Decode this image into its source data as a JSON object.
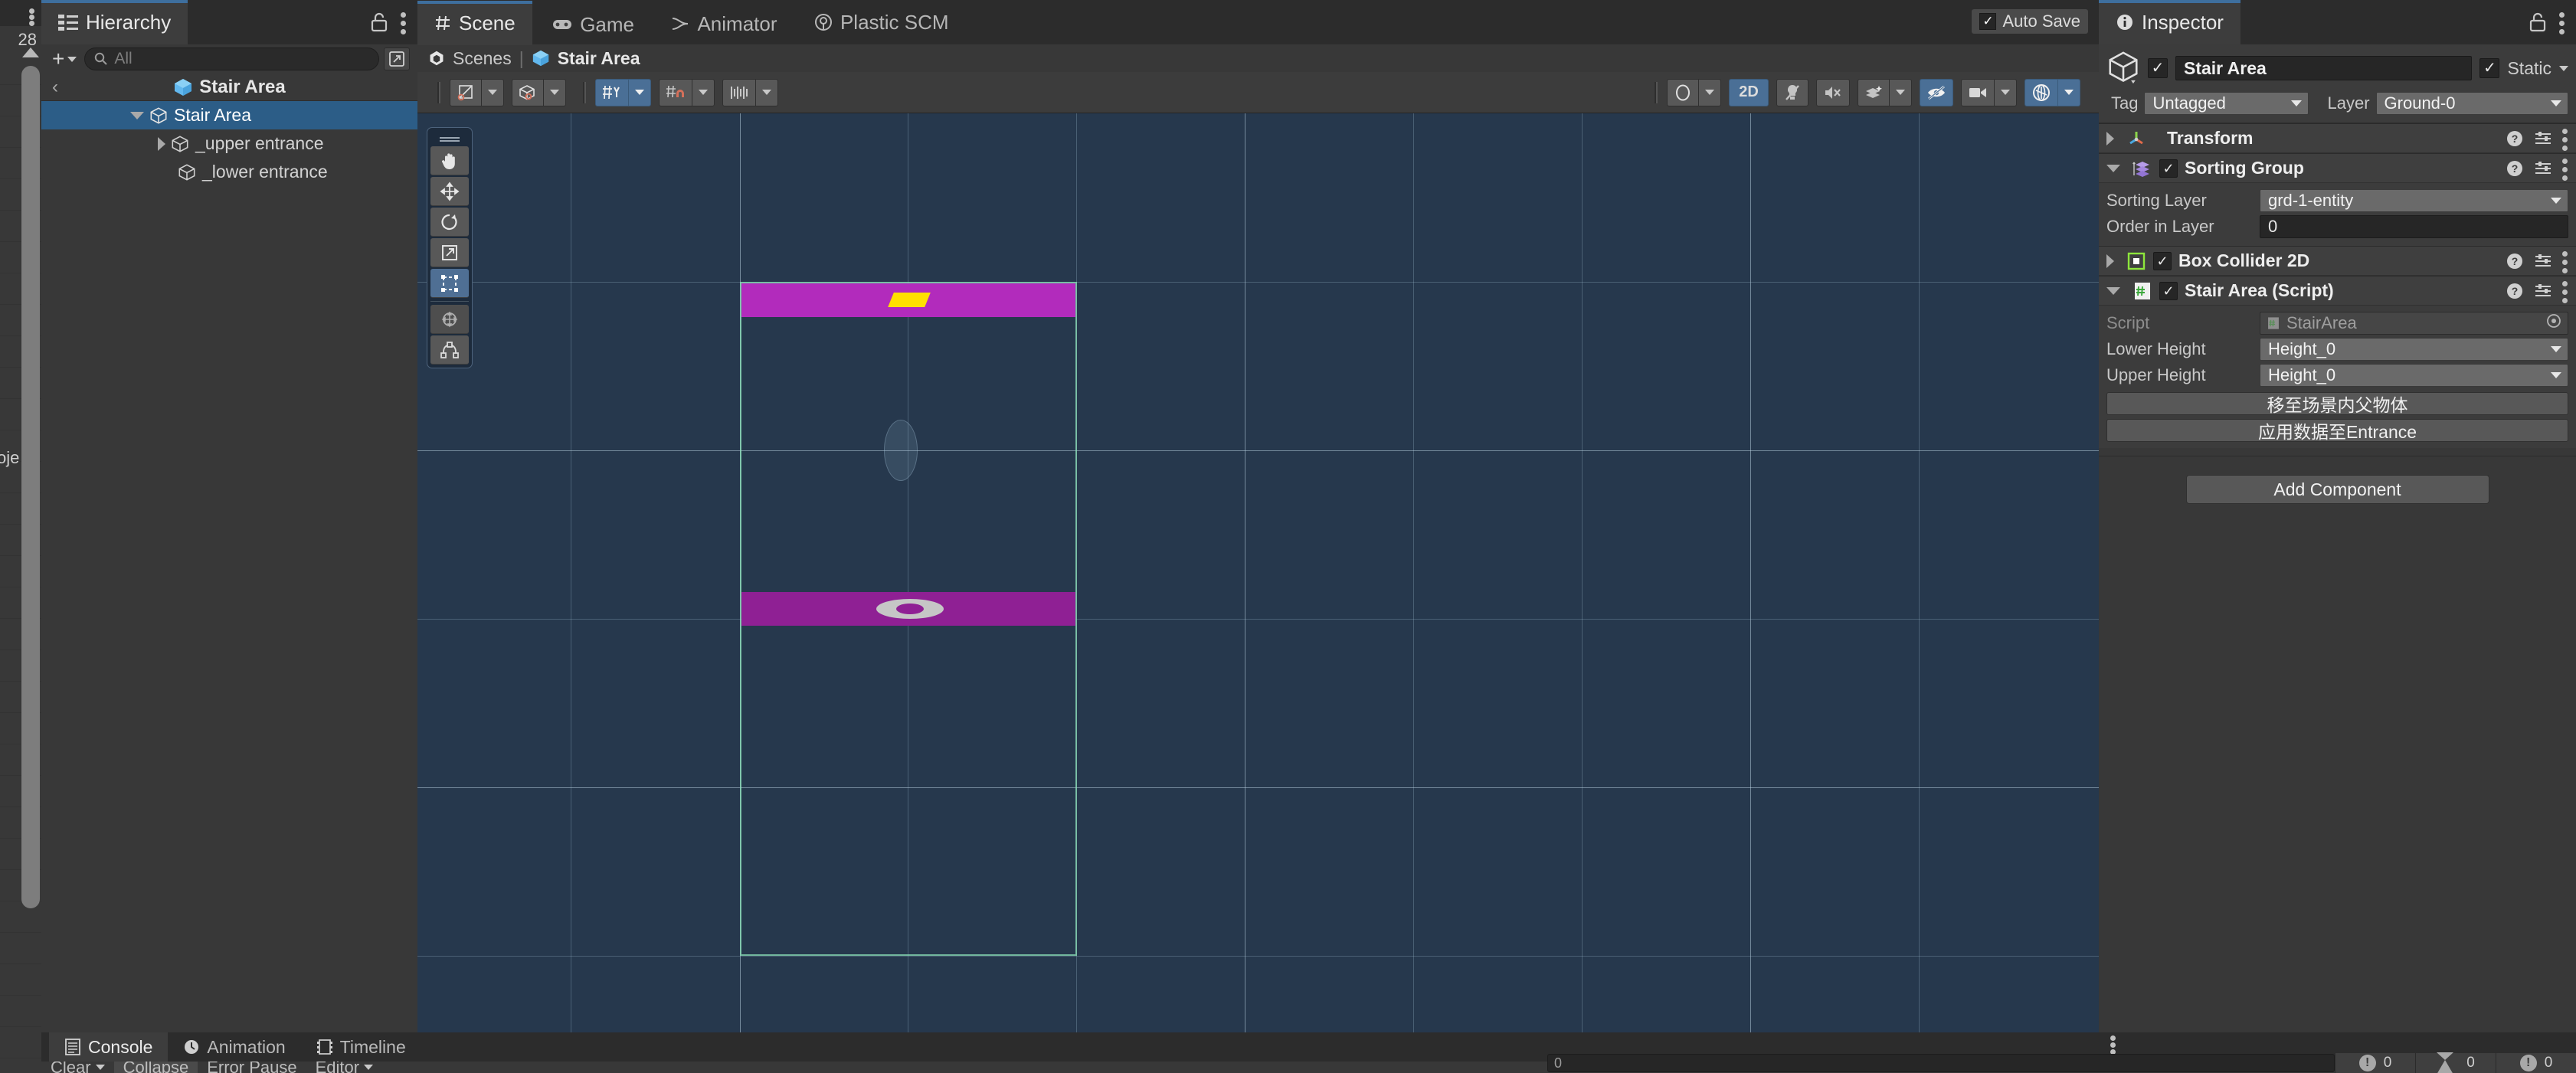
{
  "left_sliver": {
    "number": "28",
    "word": "oje"
  },
  "hierarchy": {
    "tab_label": "Hierarchy",
    "tab_icon": "list-icon",
    "lock_icon": "lock-icon",
    "menu_icon": "kebab-menu-icon",
    "add_label": "+",
    "search_placeholder": "All",
    "search_icon": "search-icon",
    "expand_icon": "open-in-new-icon",
    "breadcrumb": "Stair Area",
    "back_icon": "chevron-left-icon",
    "items": [
      {
        "label": "Stair Area",
        "depth": 1,
        "expanded": true,
        "selected": true,
        "icon": "prefab-cube-icon"
      },
      {
        "label": "_upper entrance",
        "depth": 2,
        "expanded": false,
        "selected": false,
        "icon": "gameobject-cube-icon"
      },
      {
        "label": "_lower entrance",
        "depth": 2,
        "expanded": null,
        "selected": false,
        "icon": "gameobject-cube-icon"
      }
    ]
  },
  "scene": {
    "tabs": [
      {
        "label": "Scene",
        "icon": "hash-icon",
        "active": true
      },
      {
        "label": "Game",
        "icon": "gamepad-icon",
        "active": false
      },
      {
        "label": "Animator",
        "icon": "animator-icon",
        "active": false
      },
      {
        "label": "Plastic SCM",
        "icon": "plastic-scm-icon",
        "active": false
      }
    ],
    "autosave_label": "Auto Save",
    "autosave_checked": true,
    "breadcrumb_scenes": "Scenes",
    "breadcrumb_separator": "|",
    "breadcrumb_current": "Stair Area",
    "toolbar_left": [
      {
        "name": "shading-mode-button",
        "icon": "wireframe-shaded-icon",
        "dropdown": true,
        "on": false
      },
      {
        "name": "draw-mode-button",
        "icon": "cube-shaded-icon",
        "dropdown": true,
        "on": false
      },
      {
        "name": "grid-axis-button",
        "icon": "grid-y-axis-icon",
        "dropdown": true,
        "on": true,
        "text": "Y"
      },
      {
        "name": "grid-snap-button",
        "icon": "grid-snap-magnet-icon",
        "dropdown": true,
        "on": false
      },
      {
        "name": "snap-increment-button",
        "icon": "snap-increment-icon",
        "dropdown": true,
        "on": false
      }
    ],
    "toolbar_right": [
      {
        "name": "scene-gizmo-toggle",
        "icon": "gizmo-ring-icon",
        "dropdown": true,
        "on": false
      },
      {
        "name": "2d-toggle",
        "icon": "text-2d-icon",
        "label": "2D",
        "on": true
      },
      {
        "name": "lighting-toggle",
        "icon": "light-off-icon",
        "on": false
      },
      {
        "name": "audio-toggle",
        "icon": "speaker-mute-icon",
        "on": false
      },
      {
        "name": "fx-toggle",
        "icon": "fx-sparkle-icon",
        "dropdown": true,
        "on": false
      },
      {
        "name": "hidden-objects-toggle",
        "icon": "eye-slash-icon",
        "on": true
      },
      {
        "name": "camera-settings-button",
        "icon": "camera-icon",
        "dropdown": true,
        "on": false
      },
      {
        "name": "gizmos-toggle",
        "icon": "gizmos-globe-icon",
        "dropdown": true,
        "on": true
      }
    ],
    "tool_palette": [
      {
        "name": "hand-tool",
        "icon": "hand-icon",
        "active": false
      },
      {
        "name": "move-tool",
        "icon": "move-arrows-icon",
        "active": false
      },
      {
        "name": "rotate-tool",
        "icon": "rotate-icon",
        "active": false
      },
      {
        "name": "scale-tool",
        "icon": "scale-icon",
        "active": false
      },
      {
        "name": "rect-tool",
        "icon": "rect-transform-icon",
        "active": true
      },
      {
        "name": "transform-tool",
        "icon": "move-rotate-scale-icon",
        "active": false,
        "dim": true
      },
      {
        "name": "custom-editor-tool",
        "icon": "custom-tool-icon",
        "active": false
      }
    ],
    "viewport": {
      "background_color": "#26384d",
      "grid_color": "#a0bed2",
      "selection_outline_color": "#7fe0b0",
      "upper_band_color": "#b22bbc",
      "lower_band_color": "#8f2094",
      "upper_marker_color": "#ffe000",
      "lower_marker_color": "#c6c6c6",
      "pivot_circle_color": "#35506c"
    }
  },
  "inspector": {
    "tab_label": "Inspector",
    "tab_icon": "info-icon",
    "lock_icon": "lock-icon",
    "menu_icon": "kebab-menu-icon",
    "object": {
      "icon": "gameobject-cube-icon",
      "enabled": true,
      "name": "Stair Area",
      "static_label": "Static",
      "static_checked": true,
      "tag_label": "Tag",
      "tag_value": "Untagged",
      "layer_label": "Layer",
      "layer_value": "Ground-0"
    },
    "components": [
      {
        "name": "Transform",
        "icon": "transform-axes-icon",
        "expanded": false,
        "has_checkbox": false,
        "help_icon": "help-icon",
        "preset_icon": "preset-icon",
        "menu_icon": "kebab-menu-icon"
      },
      {
        "name": "Sorting Group",
        "icon": "sorting-group-icon",
        "expanded": true,
        "has_checkbox": true,
        "checked": true,
        "help_icon": "help-icon",
        "preset_icon": "preset-icon",
        "menu_icon": "kebab-menu-icon",
        "fields": [
          {
            "type": "dropdown",
            "label": "Sorting Layer",
            "value": "grd-1-entity"
          },
          {
            "type": "input",
            "label": "Order in Layer",
            "value": "0"
          }
        ]
      },
      {
        "name": "Box Collider 2D",
        "icon": "box-collider-2d-icon",
        "expanded": false,
        "has_checkbox": true,
        "checked": true,
        "help_icon": "help-icon",
        "preset_icon": "preset-icon",
        "menu_icon": "kebab-menu-icon"
      },
      {
        "name": "Stair Area (Script)",
        "icon": "csharp-script-icon",
        "expanded": true,
        "has_checkbox": true,
        "checked": true,
        "help_icon": "help-icon",
        "preset_icon": "preset-icon",
        "menu_icon": "kebab-menu-icon",
        "fields": [
          {
            "type": "object",
            "label": "Script",
            "value": "StairArea",
            "icon": "csharp-script-icon",
            "picker_icon": "object-picker-icon",
            "disabled": true
          },
          {
            "type": "dropdown",
            "label": "Lower Height",
            "value": "Height_0"
          },
          {
            "type": "dropdown",
            "label": "Upper Height",
            "value": "Height_0"
          },
          {
            "type": "button",
            "label": "移至场景内父物体"
          },
          {
            "type": "button",
            "label": "应用数据至Entrance"
          }
        ]
      }
    ],
    "add_component_label": "Add Component"
  },
  "bottom": {
    "tabs": [
      {
        "label": "Console",
        "icon": "console-icon",
        "active": true
      },
      {
        "label": "Animation",
        "icon": "clock-icon",
        "active": false
      },
      {
        "label": "Timeline",
        "icon": "film-icon",
        "active": false
      }
    ],
    "menu_icon": "kebab-menu-icon",
    "console_tools": [
      {
        "label": "Clear",
        "dropdown": true
      },
      {
        "label": "Collapse",
        "dropdown": false
      },
      {
        "label": "Error Pause",
        "dropdown": false
      },
      {
        "label": "Editor",
        "dropdown": true
      }
    ]
  },
  "statusbar": {
    "search_value": "0",
    "counts": [
      {
        "icon": "error-icon",
        "value": "0"
      },
      {
        "icon": "warning-icon",
        "value": "0"
      },
      {
        "icon": "info-icon",
        "value": "0"
      }
    ]
  }
}
